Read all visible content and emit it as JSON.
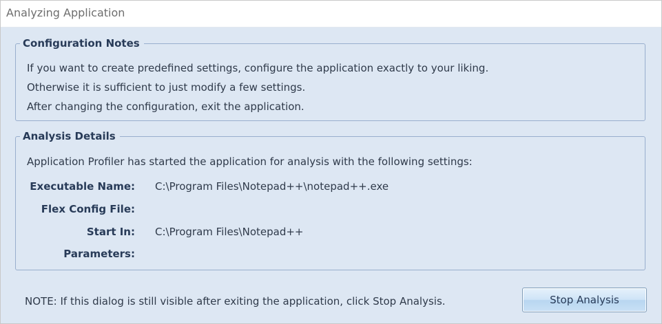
{
  "window": {
    "title": "Analyzing Application"
  },
  "config_notes": {
    "heading": "Configuration Notes",
    "lines": [
      "If you want to create predefined settings, configure the application exactly to your liking.",
      "Otherwise it is sufficient to just modify a few settings.",
      "After changing the configuration, exit the application."
    ]
  },
  "analysis_details": {
    "heading": "Analysis Details",
    "intro": "Application Profiler has started the application for analysis with the following settings:",
    "fields": [
      {
        "label": "Executable Name:",
        "value": "C:\\Program Files\\Notepad++\\notepad++.exe"
      },
      {
        "label": "Flex Config File:",
        "value": ""
      },
      {
        "label": "Start In:",
        "value": "C:\\Program Files\\Notepad++"
      },
      {
        "label": "Parameters:",
        "value": ""
      }
    ]
  },
  "footer": {
    "note": "NOTE: If this dialog is still visible after exiting the application, click Stop Analysis.",
    "stop_button_label": "Stop Analysis"
  }
}
